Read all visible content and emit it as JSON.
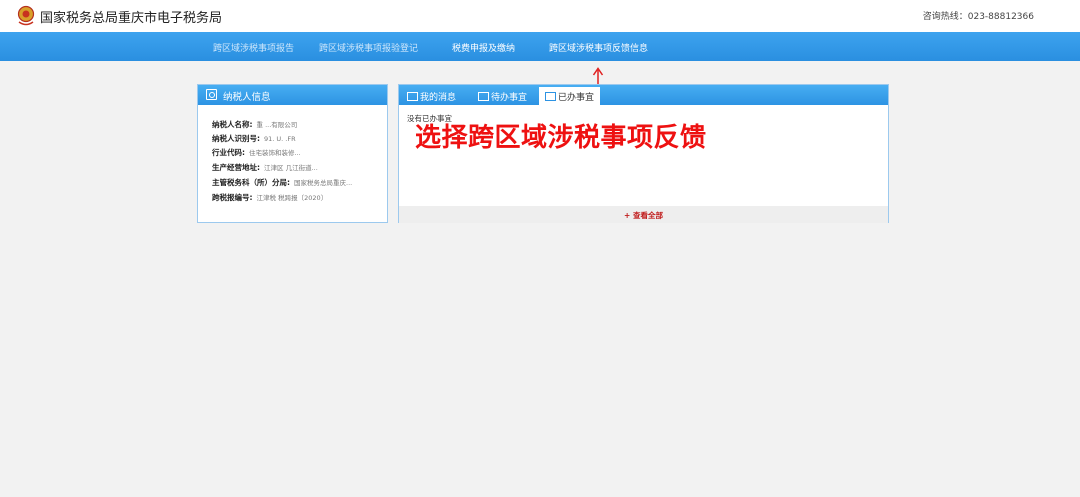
{
  "header": {
    "title": "国家税务总局重庆市电子税务局",
    "hotline": "咨询热线：023-88812366"
  },
  "nav": {
    "items": [
      {
        "label": "跨区域涉税事项报告"
      },
      {
        "label": "跨区域涉税事项报验登记"
      },
      {
        "label": "税费申报及缴纳"
      },
      {
        "label": "跨区域涉税事项反馈信息"
      }
    ]
  },
  "taxpayer": {
    "title": "纳税人信息",
    "fields": [
      {
        "label": "纳税人名称:",
        "value": "重                     ...有限公司"
      },
      {
        "label": "纳税人识别号:",
        "value": "91.              U.      .FR"
      },
      {
        "label": "行业代码:",
        "value": "住宅装饰和装修..."
      },
      {
        "label": "生产经营地址:",
        "value": "江津区 几江街道..."
      },
      {
        "label": "主管税务科（所）分局:",
        "value": "国家税务总局重庆..."
      },
      {
        "label": "跨税报编号:",
        "value": "江津税 税跨报〔2020〕"
      }
    ]
  },
  "messages": {
    "tabs": [
      {
        "label": "我的消息"
      },
      {
        "label": "待办事宜"
      },
      {
        "label": "已办事宜"
      }
    ],
    "empty_text": "没有已办事宜",
    "view_all": "+ 查看全部"
  },
  "annotation": {
    "text": "选择跨区域涉税事项反馈",
    "color": "#ee1111"
  }
}
